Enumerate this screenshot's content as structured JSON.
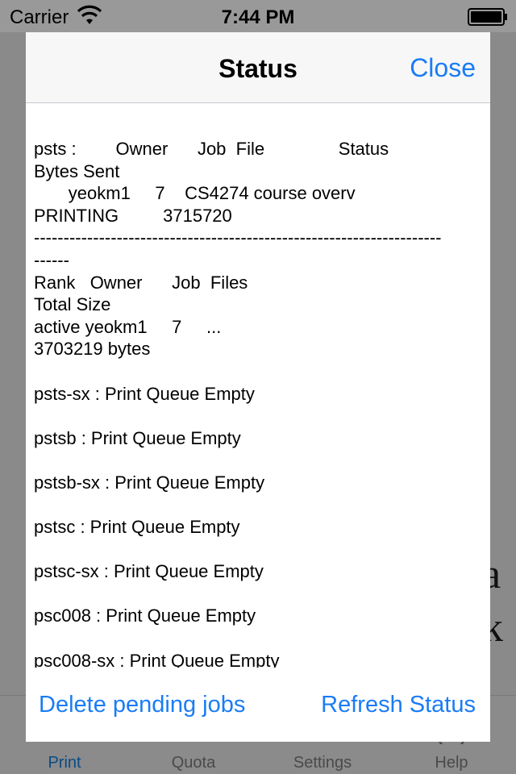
{
  "status_bar": {
    "carrier": "Carrier",
    "time": "7:44 PM"
  },
  "background": {
    "glyphs": [
      "a",
      "k"
    ],
    "tabs": [
      {
        "label": "Print",
        "icon": "printer-icon",
        "active": true
      },
      {
        "label": "Quota",
        "icon": "quota-icon",
        "active": false
      },
      {
        "label": "Settings",
        "icon": "settings-icon",
        "active": false
      },
      {
        "label": "Help",
        "icon": "help-icon",
        "active": false
      }
    ]
  },
  "modal": {
    "title": "Status",
    "close_label": "Close",
    "status_text": "psts :        Owner      Job  File               Status\nBytes Sent\n       yeokm1     7    CS4274 course overv\nPRINTING         3715720\n---------------------------------------------------------------------\n------\nRank   Owner      Job  Files\nTotal Size\nactive yeokm1     7     ...\n3703219 bytes\n\npsts-sx : Print Queue Empty\n\npstsb : Print Queue Empty\n\npstsb-sx : Print Queue Empty\n\npstsc : Print Queue Empty\n\npstsc-sx : Print Queue Empty\n\npsc008 : Print Queue Empty\n\npsc008-sx : Print Queue Empty",
    "delete_label": "Delete pending jobs",
    "refresh_label": "Refresh Status"
  },
  "colors": {
    "accent": "#1a7cf5",
    "overlay": "#8e8e8e"
  }
}
